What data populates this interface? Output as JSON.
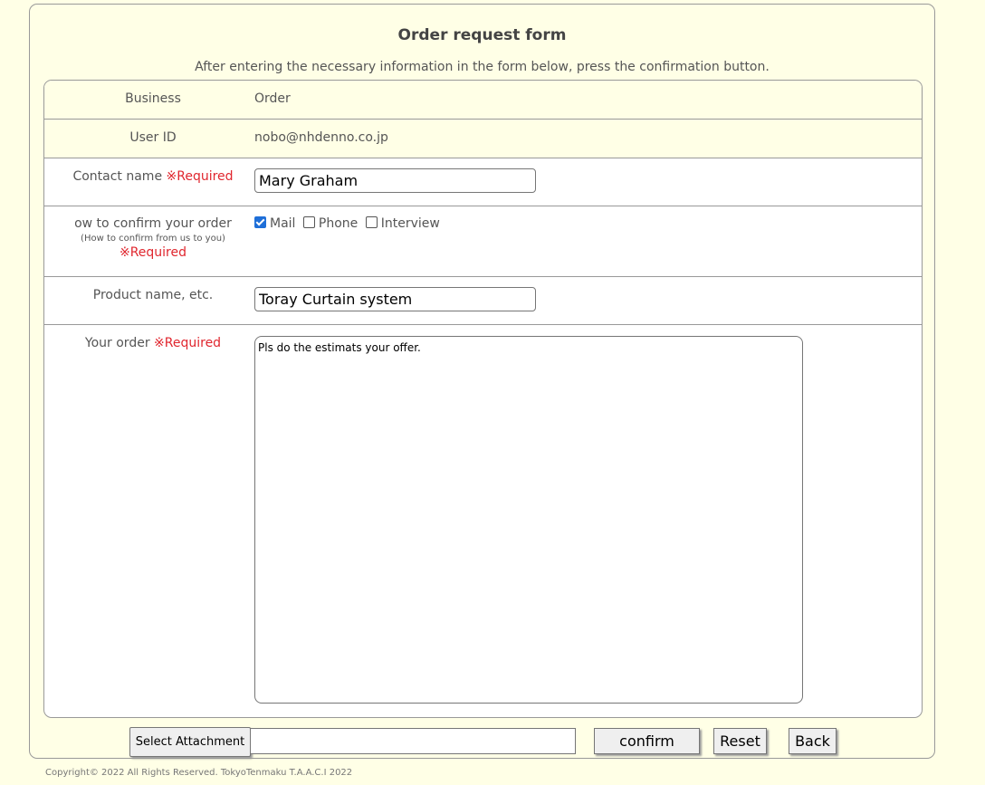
{
  "page": {
    "title": "Order request form",
    "subtitle": "After entering the necessary information in the form below, press the confirmation button."
  },
  "form": {
    "business": {
      "label": "Business",
      "value": "Order"
    },
    "user_id": {
      "label": "User ID",
      "value": "nobo@nhdenno.co.jp"
    },
    "contact_name": {
      "label": "Contact name",
      "required": "※Required",
      "value": "Mary Graham"
    },
    "confirm_method": {
      "label": "ow to confirm your order",
      "note": "(How to confirm from us to you)",
      "required": "※Required",
      "options": [
        {
          "label": "Mail",
          "checked": true
        },
        {
          "label": "Phone",
          "checked": false
        },
        {
          "label": "Interview",
          "checked": false
        }
      ]
    },
    "product_name": {
      "label": "Product name, etc.",
      "value": "Toray Curtain system"
    },
    "your_order": {
      "label": "Your order",
      "required": "※Required",
      "value": "Pls do the estimats your offer."
    }
  },
  "actions": {
    "select_attachment": "Select Attachment",
    "attachment_value": "",
    "confirm": "confirm",
    "reset": "Reset",
    "back": "Back"
  },
  "footer": {
    "copyright": "Copyright© 2022 All Rights Reserved. TokyoTenmaku T.A.A.C.I 2022"
  }
}
